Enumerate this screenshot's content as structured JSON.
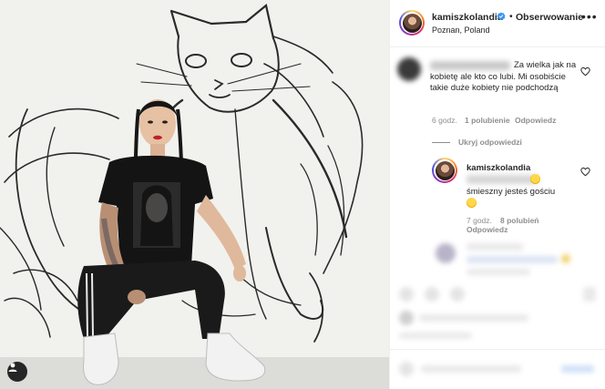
{
  "post": {
    "username": "kamiszkolandia",
    "follow_label": "Obserwowanie",
    "separator": "•",
    "location": "Poznan, Poland",
    "more_label": "•••",
    "verified_icon": "verified-badge-icon",
    "accent_color": "#3897f0"
  },
  "comments": [
    {
      "text": "Za wielka jak na kobietę ale kto co lubi. Mi osobiście takie duże kobiety nie podchodzą",
      "time": "6 godz.",
      "likes": "1 polubienie",
      "reply_label": "Odpowiedz"
    }
  ],
  "hide_replies_label": "Ukryj odpowiedzi",
  "reply": {
    "username": "kamiszkolandia",
    "text": "śmieszny jesteś gościu",
    "time": "7 godz.",
    "likes": "8 polubień",
    "reply_label": "Odpowiedz"
  }
}
